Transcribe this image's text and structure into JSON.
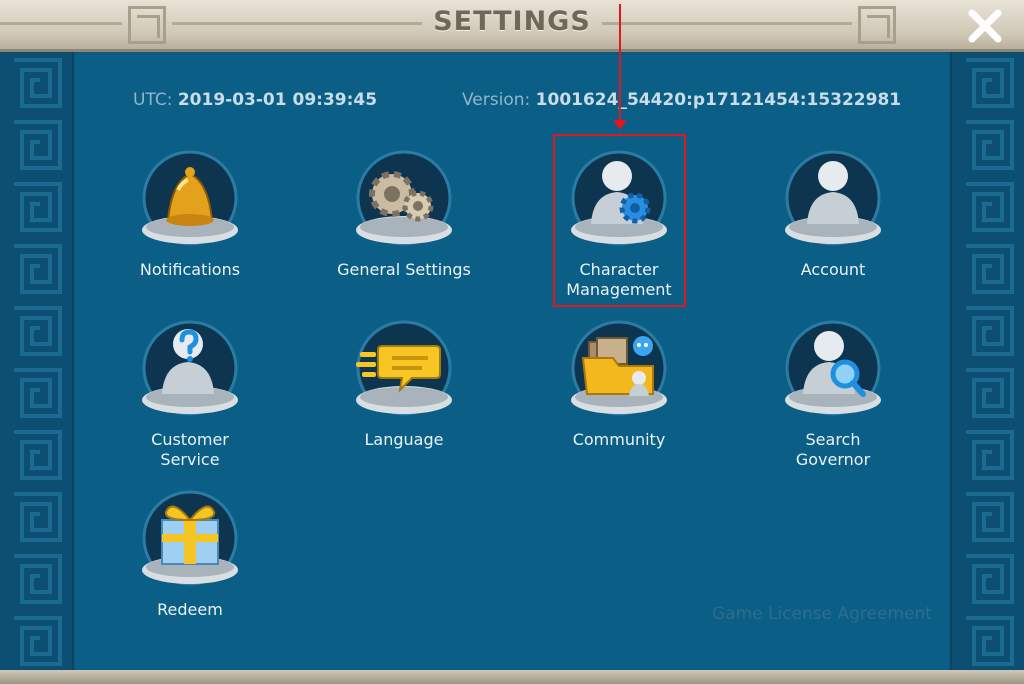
{
  "header": {
    "title": "SETTINGS",
    "close_icon": "close-x-icon"
  },
  "info": {
    "utc_label": "UTC:",
    "utc_value": "2019-03-01 09:39:45",
    "version_label": "Version:",
    "version_value": "1001624_54420:p17121454:15322981"
  },
  "tiles": [
    {
      "label": "Notifications",
      "icon": "bell-icon"
    },
    {
      "label": "General Settings",
      "icon": "gears-icon"
    },
    {
      "label_line1": "Character",
      "label_line2": "Management",
      "icon": "character-gear-icon"
    },
    {
      "label": "Account",
      "icon": "account-icon"
    },
    {
      "label_line1": "Customer",
      "label_line2": "Service",
      "icon": "customer-service-icon"
    },
    {
      "label": "Language",
      "icon": "speech-bubble-icon"
    },
    {
      "label": "Community",
      "icon": "community-folder-icon"
    },
    {
      "label_line1": "Search",
      "label_line2": "Governor",
      "icon": "search-governor-icon"
    },
    {
      "label": "Redeem",
      "icon": "gift-icon"
    }
  ],
  "footer": {
    "license_link": "Game License Agreement"
  },
  "colors": {
    "panel": "#0b5e86",
    "border": "#0c4f73",
    "titlebar": "#cfc8b6",
    "highlight": "#e3161d"
  }
}
